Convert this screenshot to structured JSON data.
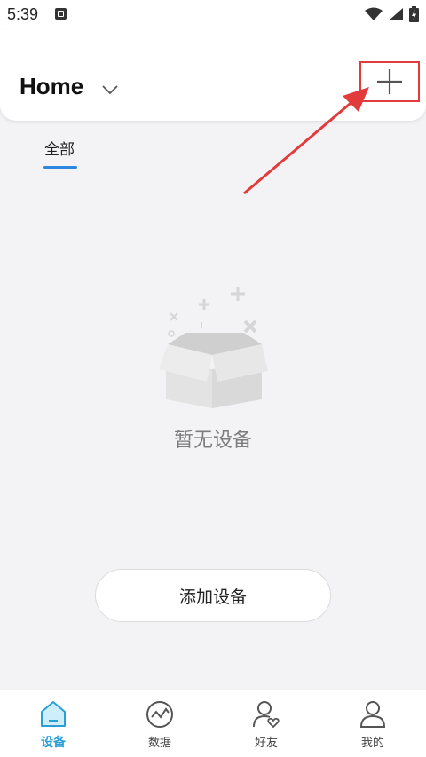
{
  "status_bar": {
    "time": "5:39",
    "icons": [
      "notification-a-icon",
      "wifi-icon",
      "signal-icon",
      "battery-charging-icon"
    ]
  },
  "header": {
    "title": "Home",
    "chevron_icon": "chevron-down-icon",
    "add_icon": "plus-icon"
  },
  "tabs": [
    {
      "label": "全部",
      "active": true
    }
  ],
  "empty_state": {
    "icon": "empty-box-icon",
    "text": "暂无设备"
  },
  "add_device_button": {
    "label": "添加设备"
  },
  "bottom_nav": [
    {
      "label": "设备",
      "icon": "home-icon",
      "active": true
    },
    {
      "label": "数据",
      "icon": "chart-circle-icon",
      "active": false
    },
    {
      "label": "好友",
      "icon": "friend-heart-icon",
      "active": false
    },
    {
      "label": "我的",
      "icon": "profile-icon",
      "active": false
    }
  ],
  "colors": {
    "accent": "#2a9fd6",
    "tab_underline": "#2f86e0",
    "annotation_red": "#e23b3b",
    "background": "#f3f3f5"
  }
}
